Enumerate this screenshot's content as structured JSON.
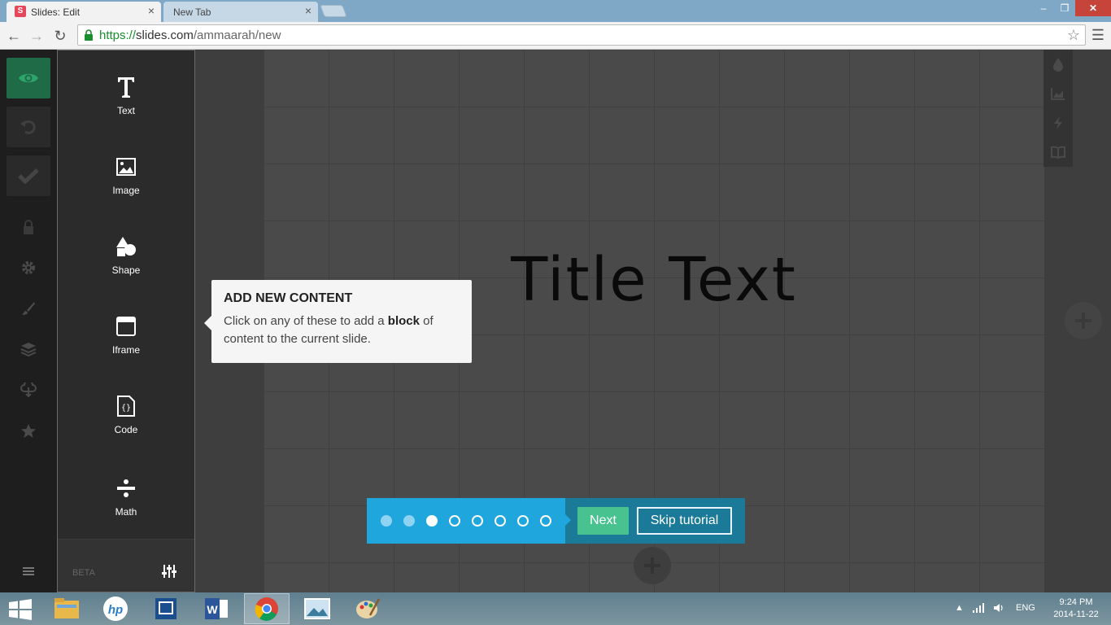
{
  "browser": {
    "tabs": [
      {
        "label": "Slides: Edit",
        "favicon": "S"
      },
      {
        "label": "New Tab"
      }
    ],
    "close_glyph": "×",
    "url_scheme": "https://",
    "url_host": "slides.com",
    "url_path": "/ammaarah/new",
    "window_controls": {
      "minimize": "‒",
      "maximize": "❐",
      "close": "✕"
    }
  },
  "left_rail": {
    "items": [
      "eye-icon",
      "undo-icon",
      "check-icon",
      "lock-icon",
      "gear-icon",
      "brush-icon",
      "layers-icon",
      "cloud-icon",
      "star-icon",
      "menu-icon"
    ]
  },
  "content_panel": {
    "items": [
      {
        "label": "Text",
        "icon": "text-icon"
      },
      {
        "label": "Image",
        "icon": "image-icon"
      },
      {
        "label": "Shape",
        "icon": "shape-icon"
      },
      {
        "label": "Iframe",
        "icon": "iframe-icon"
      },
      {
        "label": "Code",
        "icon": "code-icon"
      },
      {
        "label": "Math",
        "icon": "math-icon"
      }
    ],
    "footer_label": "BETA"
  },
  "slide": {
    "title": "Title Text"
  },
  "popover": {
    "title": "ADD NEW CONTENT",
    "body_before": "Click on any of these to add a ",
    "body_bold": "block",
    "body_after": " of content to the current slide."
  },
  "tutorial": {
    "total_steps": 8,
    "current_step": 3,
    "next_label": "Next",
    "skip_label": "Skip tutorial"
  },
  "taskbar": {
    "language": "ENG",
    "time": "9:24 PM",
    "date": "2014-11-22"
  },
  "colors": {
    "accent_green": "#48c390",
    "tutorial_blue": "#1fa6dc",
    "tutorial_dark": "#1a7a98"
  }
}
